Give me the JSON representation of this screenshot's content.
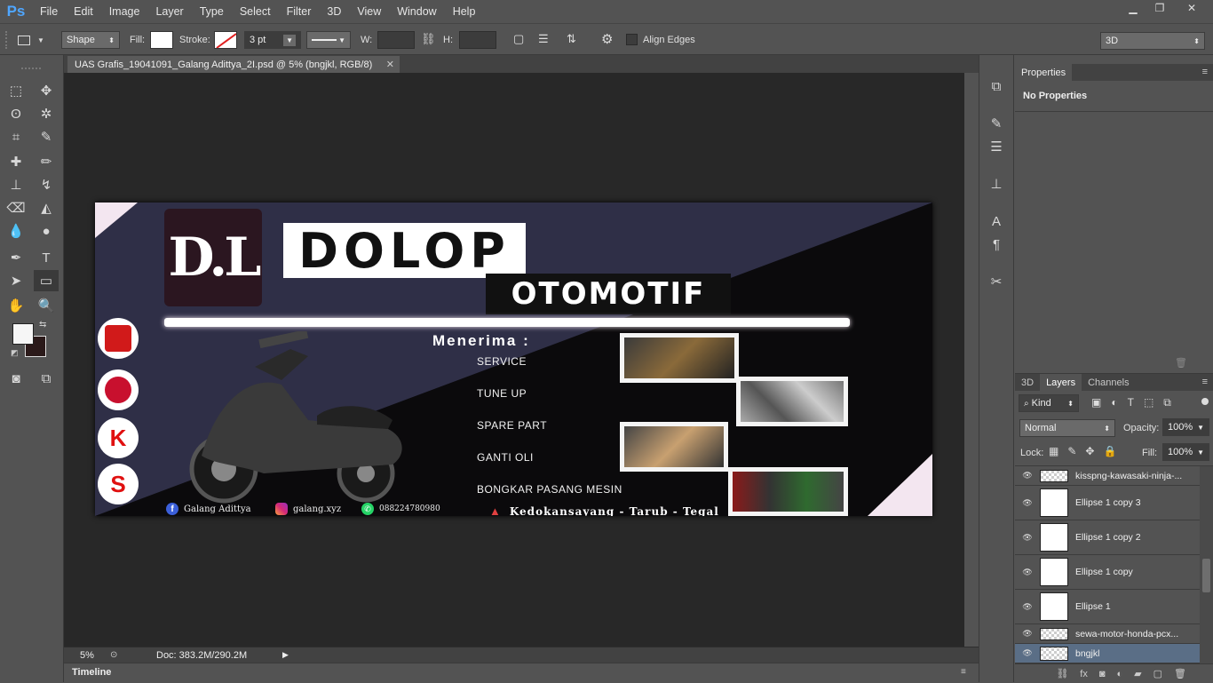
{
  "app": {
    "logo": "Ps"
  },
  "menu": [
    "File",
    "Edit",
    "Image",
    "Layer",
    "Type",
    "Select",
    "Filter",
    "3D",
    "View",
    "Window",
    "Help"
  ],
  "window_controls": [
    "minimize-icon",
    "restore-icon",
    "close-icon"
  ],
  "options": {
    "mode": "Shape",
    "fill_label": "Fill:",
    "stroke_label": "Stroke:",
    "stroke_width": "3 pt",
    "w_label": "W:",
    "h_label": "H:",
    "align_edges": "Align Edges",
    "workspace": "3D"
  },
  "document": {
    "tab_title": "UAS Grafis_19041091_Galang Adittya_2I.psd @ 5% (bngjkl, RGB/8)",
    "zoom": "5%",
    "doc_info": "Doc: 383.2M/290.2M"
  },
  "timeline_label": "Timeline",
  "properties": {
    "tab": "Properties",
    "content": "No Properties"
  },
  "layers_panel": {
    "tabs": [
      "3D",
      "Layers",
      "Channels"
    ],
    "filter_kind": "Kind",
    "blend_mode": "Normal",
    "opacity_label": "Opacity:",
    "opacity": "100%",
    "lock_label": "Lock:",
    "fill_label": "Fill:",
    "fill": "100%",
    "layers": [
      {
        "name": "kisspng-kawasaki-ninja-..."
      },
      {
        "name": "Ellipse 1 copy 3"
      },
      {
        "name": "Ellipse 1 copy 2"
      },
      {
        "name": "Ellipse 1 copy"
      },
      {
        "name": "Ellipse 1"
      },
      {
        "name": "sewa-motor-honda-pcx..."
      },
      {
        "name": "bngjkl"
      }
    ]
  },
  "artwork": {
    "logo_initials": "D.L",
    "title": "DOLOP",
    "subtitle": "OTOMOTIF",
    "accepts": "Menerima :",
    "services": [
      "SERVICE",
      "TUNE UP",
      "SPARE PART",
      "GANTI OLI",
      "BONGKAR PASANG MESIN"
    ],
    "brands": [
      {
        "name": "honda-logo-icon",
        "glyph": "",
        "color": "#d11a1a"
      },
      {
        "name": "yamaha-logo-icon",
        "glyph": "",
        "color": "#c8102e"
      },
      {
        "name": "kawasaki-logo-icon",
        "glyph": "K",
        "color": "#e01010"
      },
      {
        "name": "suzuki-logo-icon",
        "glyph": "S",
        "color": "#e01010"
      }
    ],
    "facebook": "Galang Adittya",
    "instagram": "galang.xyz",
    "whatsapp": "088224780980",
    "address": "Kedokansayang - Tarub -  Tegal",
    "colors": {
      "navy": "#2f2f47",
      "dark": "#0b0a0c",
      "pink": "#f3e6f0"
    }
  }
}
